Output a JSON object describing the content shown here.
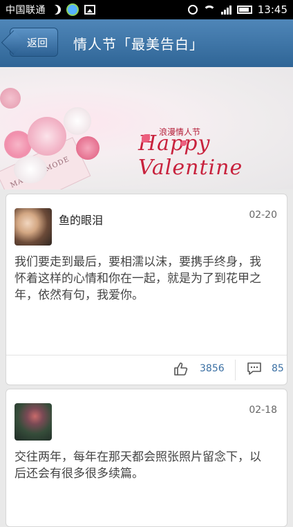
{
  "status_bar": {
    "carrier": "中国联通",
    "time": "13:45"
  },
  "header": {
    "back_label": "返回",
    "title": "情人节「最美告白」"
  },
  "banner": {
    "tag_text": "MAISON MODE",
    "small_text": "浪漫情人节",
    "big_text": "Happy Valentine"
  },
  "posts": [
    {
      "username": "鱼的眼泪",
      "date": "02-20",
      "text": "我们要走到最后，要相濡以沫，要携手终身，我怀着这样的心情和你在一起，就是为了到花甲之年，依然有句，我爱你。",
      "likes": "3856",
      "comments": "85"
    },
    {
      "username": "",
      "date": "02-18",
      "text": "交往两年，每年在那天都会照张照片留念下，以后还会有很多很多续篇。"
    }
  ],
  "colors": {
    "header": "#3a73a8",
    "accent": "#3a6fa3"
  }
}
